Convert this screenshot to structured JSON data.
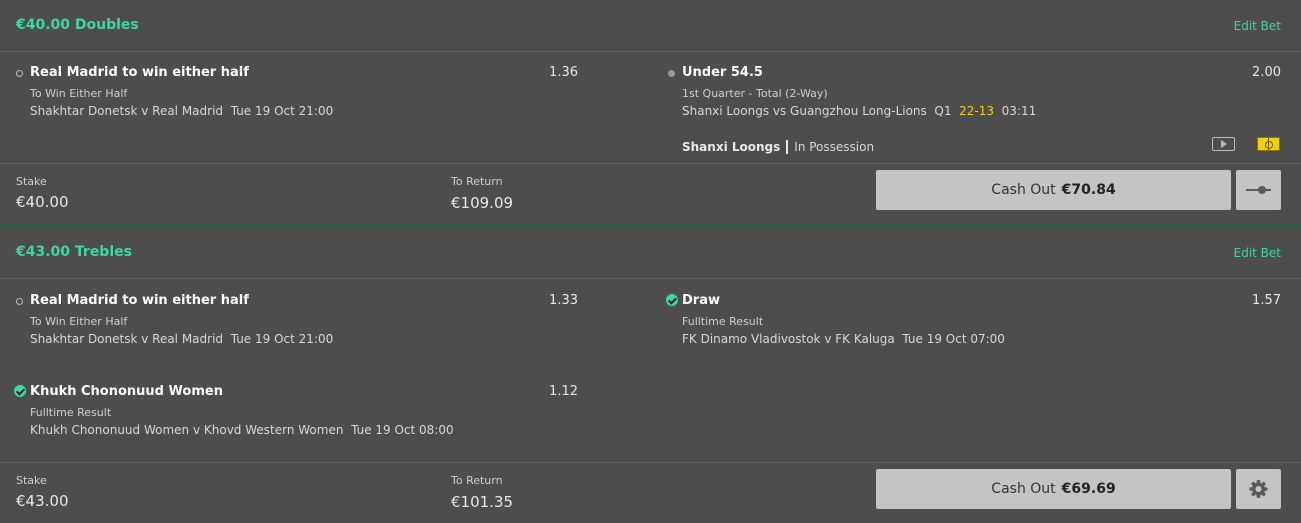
{
  "accent_color": "#3ed7a1",
  "score_color": "#f5d000",
  "bets": [
    {
      "title": "€40.00 Doubles",
      "edit_label": "Edit Bet",
      "selections": [
        {
          "name": "Real Madrid to win either half",
          "market": "To Win Either Half",
          "event": "Shakhtar Donetsk v Real Madrid",
          "time": "Tue 19 Oct 21:00",
          "odds": "1.36",
          "status": "open"
        },
        {
          "name": "Under 54.5",
          "market": "1st Quarter - Total (2-Way)",
          "event": "Shanxi Loongs vs Guangzhou Long-Lions",
          "period": "Q1",
          "score": "22-13",
          "clock": "03:11",
          "odds": "2.00",
          "status": "live",
          "possession_team": "Shanxi Loongs",
          "possession_label": "In Possession"
        }
      ],
      "stake_label": "Stake",
      "stake": "€40.00",
      "return_label": "To Return",
      "return": "€109.09",
      "cashout_label": "Cash Out",
      "cashout_amount": "€70.84",
      "side_icon": "slider-icon"
    },
    {
      "title": "€43.00 Trebles",
      "edit_label": "Edit Bet",
      "selections": [
        {
          "name": "Real Madrid to win either half",
          "market": "To Win Either Half",
          "event": "Shakhtar Donetsk v Real Madrid",
          "time": "Tue 19 Oct 21:00",
          "odds": "1.33",
          "status": "open"
        },
        {
          "name": "Draw",
          "market": "Fulltime Result",
          "event": "FK Dinamo Vladivostok v FK Kaluga",
          "time": "Tue 19 Oct 07:00",
          "odds": "1.57",
          "status": "won"
        },
        {
          "name": "Khukh Chononuud Women",
          "market": "Fulltime Result",
          "event": "Khukh Chononuud Women v Khovd Western Women",
          "time": "Tue 19 Oct 08:00",
          "odds": "1.12",
          "status": "won"
        }
      ],
      "stake_label": "Stake",
      "stake": "€43.00",
      "return_label": "To Return",
      "return": "€101.35",
      "cashout_label": "Cash Out",
      "cashout_amount": "€69.69",
      "side_icon": "gear-icon"
    }
  ]
}
